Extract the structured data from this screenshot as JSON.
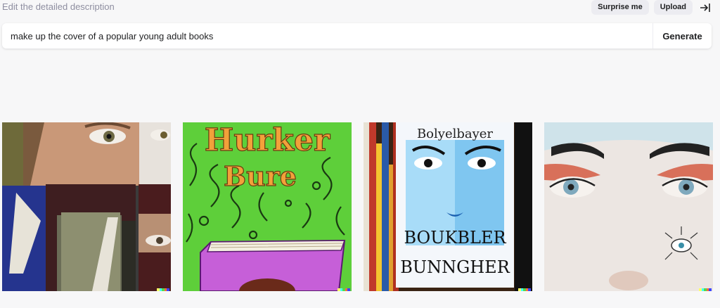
{
  "header": {
    "hint": "Edit the detailed description"
  },
  "actions": {
    "surprise_label": "Surprise me",
    "upload_label": "Upload"
  },
  "prompt": {
    "value": "make up the cover of a popular young adult books",
    "generate_label": "Generate"
  },
  "images": [
    {
      "label": ""
    },
    {
      "title_line1": "Hurker",
      "title_line2": "Bure"
    },
    {
      "top_text": "Bolyelbayer",
      "title_line1": "BOUKBLER",
      "title_line2": "BUNNGHER"
    },
    {
      "label": ""
    }
  ],
  "colors": {
    "background": "#f7f7f8",
    "surface": "#ffffff",
    "pill": "#ececf1",
    "text": "#202123",
    "muted": "#8e8ea0"
  },
  "icons": {
    "collapse": "collapse-right-icon"
  }
}
